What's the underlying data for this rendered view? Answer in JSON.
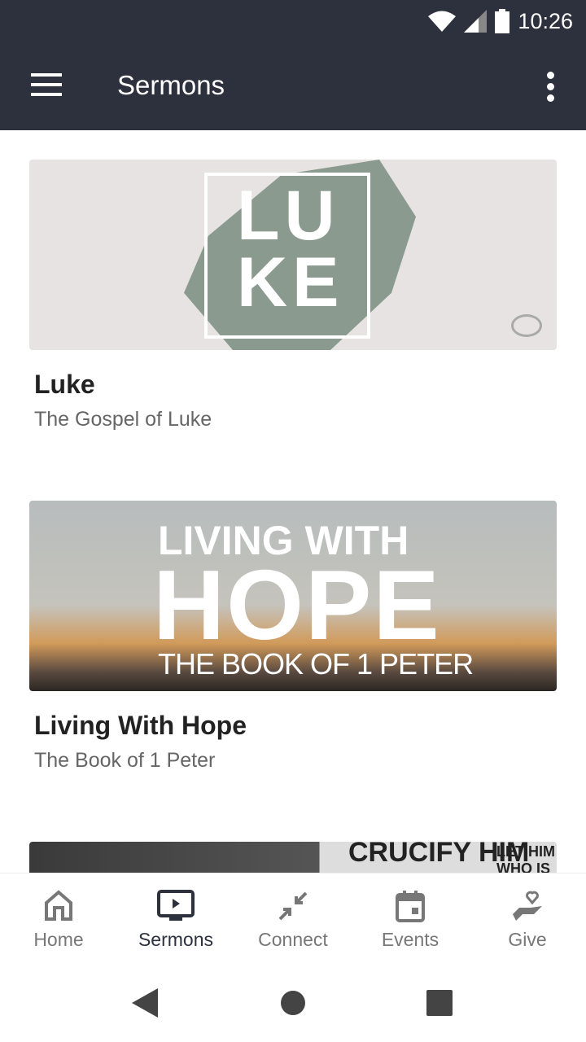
{
  "status": {
    "time": "10:26",
    "icons": [
      "wifi-icon",
      "signal-icon",
      "battery-icon"
    ]
  },
  "appbar": {
    "title": "Sermons",
    "menu_icon": "hamburger-icon",
    "more_icon": "more-vert-icon"
  },
  "series": [
    {
      "title": "Luke",
      "subtitle": "The Gospel of Luke",
      "art_text": [
        "LU",
        "KE"
      ]
    },
    {
      "title": "Living With Hope",
      "subtitle": "The Book of 1 Peter",
      "art_text": [
        "LIVING WITH",
        "HOPE",
        "THE BOOK OF 1 PETER"
      ]
    },
    {
      "art_text": [
        "CRUCIFY HIM",
        "LET HIM WHO IS"
      ]
    }
  ],
  "nav": [
    {
      "label": "Home",
      "icon": "home-icon"
    },
    {
      "label": "Sermons",
      "icon": "tv-play-icon",
      "active": true
    },
    {
      "label": "Connect",
      "icon": "connect-arrows-icon"
    },
    {
      "label": "Events",
      "icon": "calendar-icon"
    },
    {
      "label": "Give",
      "icon": "heart-hand-icon"
    }
  ],
  "colors": {
    "appbar": "#2d313d",
    "active": "#2d313d",
    "inactive": "#777777"
  }
}
